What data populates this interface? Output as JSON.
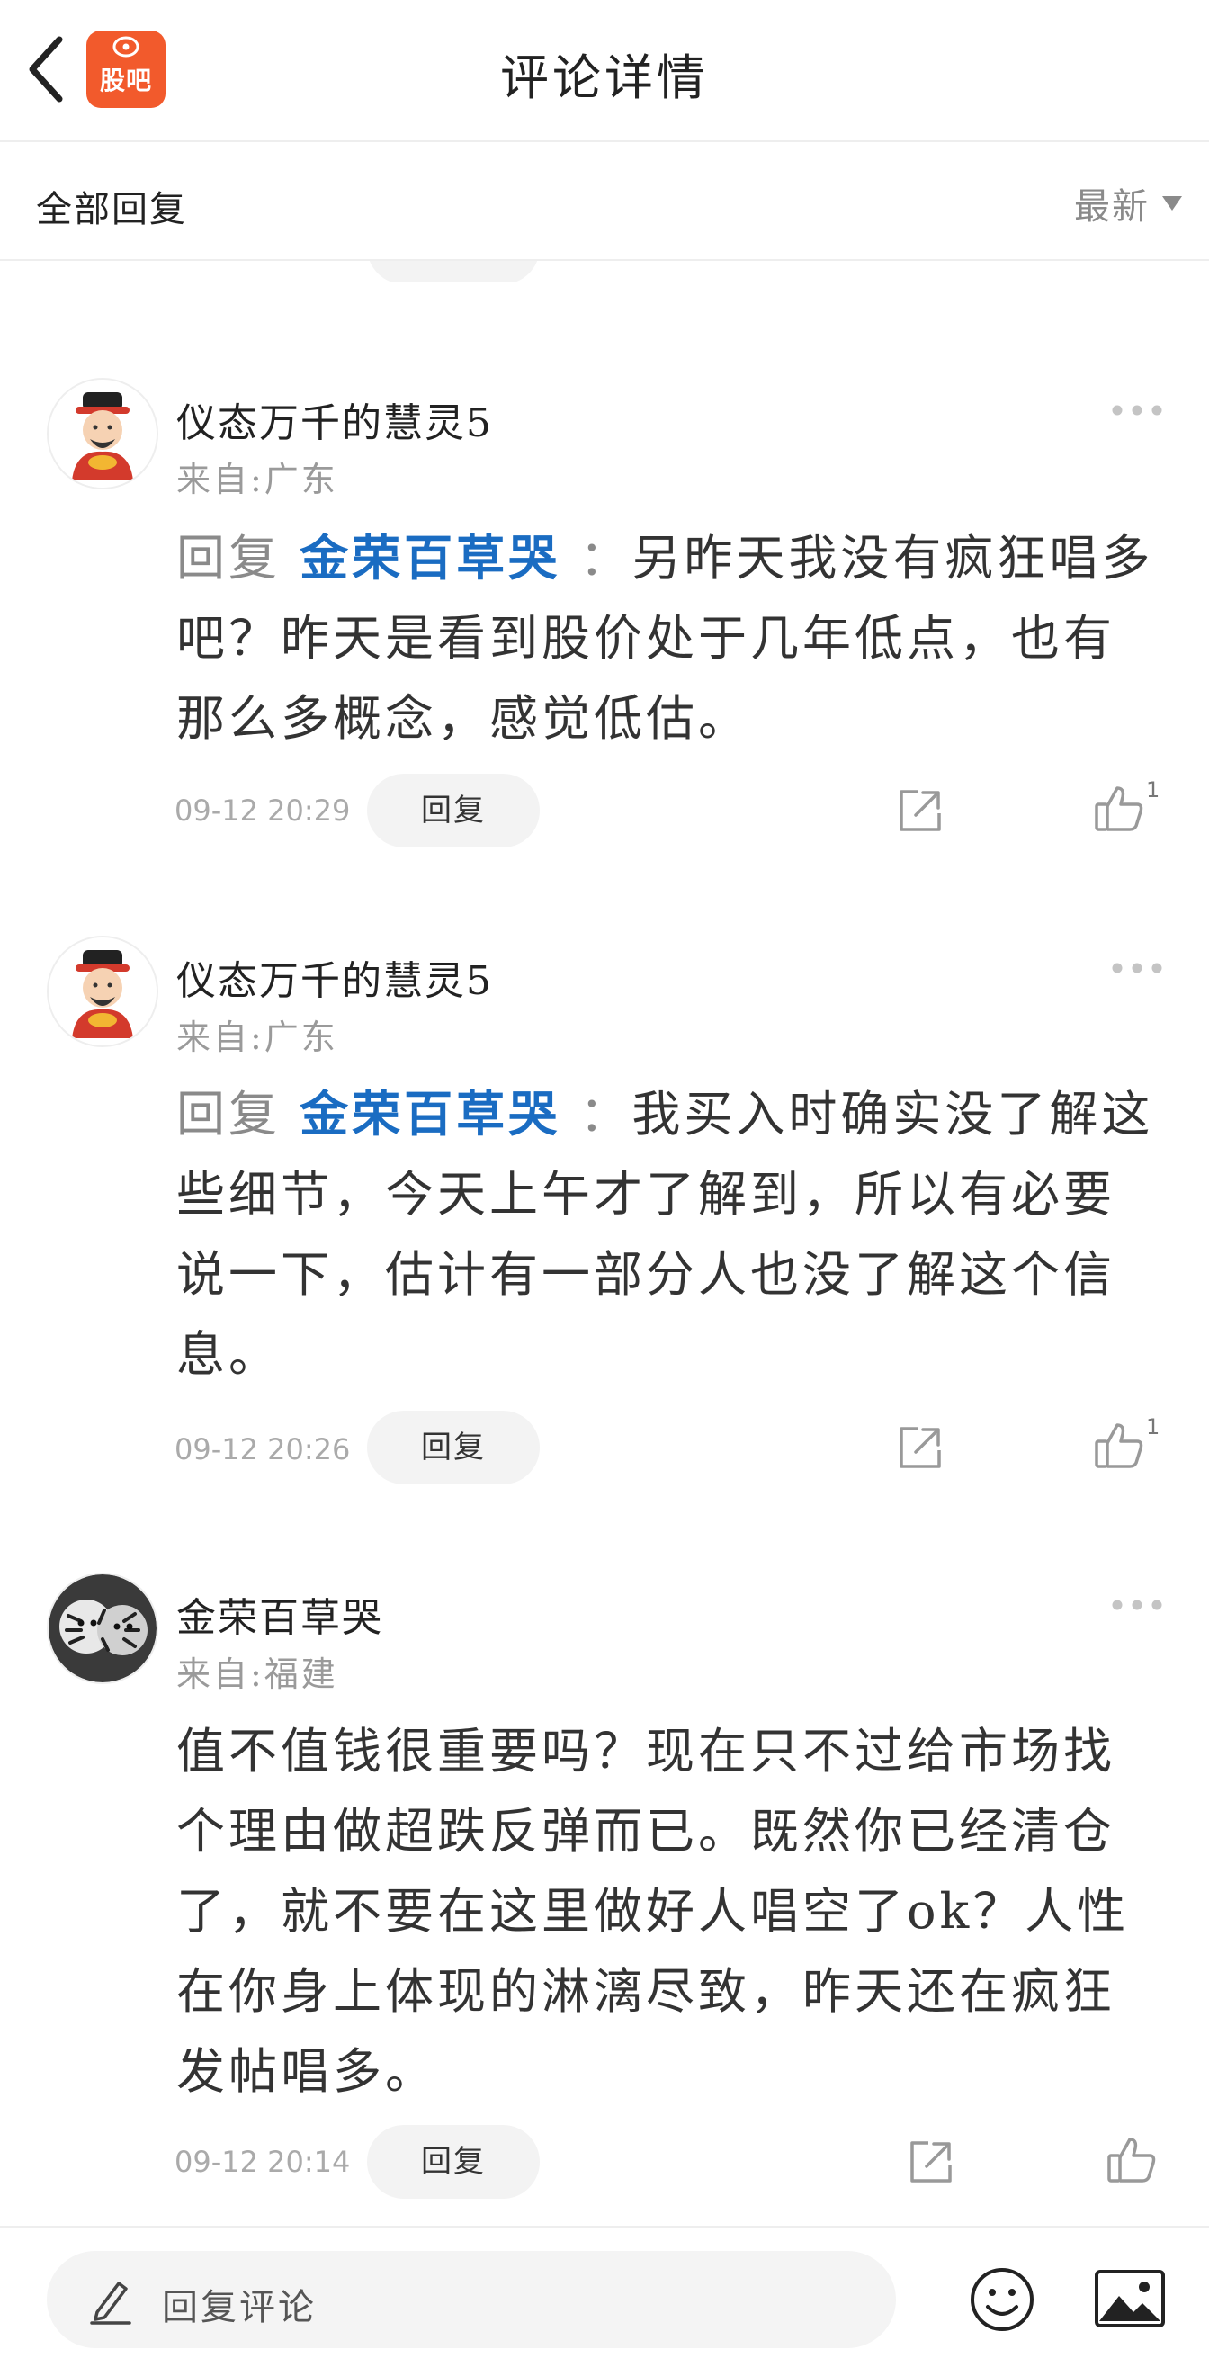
{
  "header": {
    "title": "评论详情",
    "logo_text": "股吧",
    "brand_color": "#f25a2c"
  },
  "filter": {
    "label": "全部回复",
    "sort_label": "最新"
  },
  "comments": [
    {
      "username": "仪态万千的慧灵5",
      "location": "来自:广东",
      "reply_prefix": "回复",
      "reply_target": "金荣百草哭",
      "reply_colon": "：",
      "text": "另昨天我没有疯狂唱多吧？昨天是看到股价处于几年低点，也有那么多概念，感觉低估。",
      "time": "09-12  20:29",
      "reply_button": "回复",
      "likes": "1",
      "avatar": "fortune-god-avatar"
    },
    {
      "username": "仪态万千的慧灵5",
      "location": "来自:广东",
      "reply_prefix": "回复",
      "reply_target": "金荣百草哭",
      "reply_colon": "：",
      "text": "我买入时确实没了解这些细节，今天上午才了解到，所以有必要说一下，估计有一部分人也没了解这个信息。",
      "time": "09-12  20:26",
      "reply_button": "回复",
      "likes": "1",
      "avatar": "fortune-god-avatar"
    },
    {
      "username": "金荣百草哭",
      "location": "来自:福建",
      "text": "值不值钱很重要吗？现在只不过给市场找个理由做超跌反弹而已。既然你已经清仓了，就不要在这里做好人唱空了ok？人性在你身上体现的淋漓尽致，昨天还在疯狂发帖唱多。",
      "time": "09-12  20:14",
      "reply_button": "回复",
      "avatar": "tiger-avatar"
    }
  ],
  "bottom_bar": {
    "reply_placeholder": "回复评论"
  },
  "colors": {
    "link_blue": "#1a6cc2",
    "muted_gray": "#8a8a8a",
    "button_bg": "#f3f3f3"
  }
}
